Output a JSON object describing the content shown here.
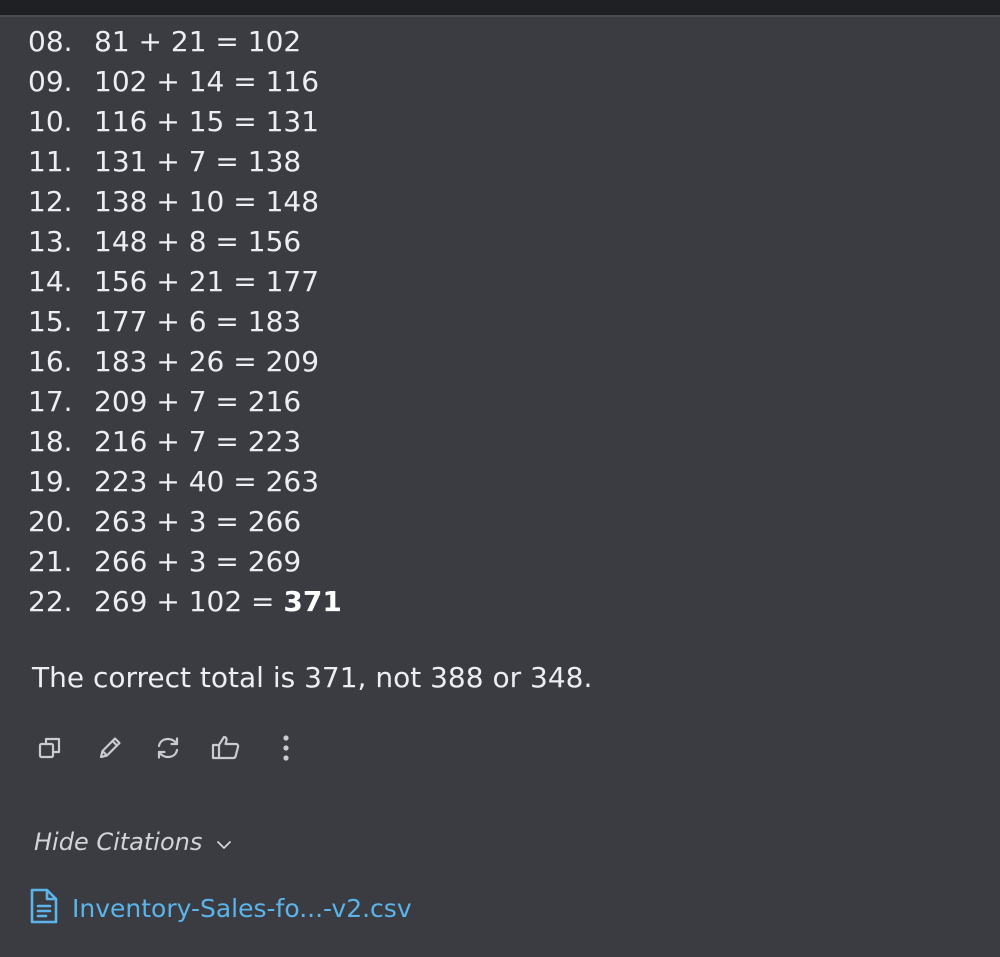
{
  "steps": [
    {
      "num": "08.",
      "expr": "81 + 21 = 102",
      "result_bold": ""
    },
    {
      "num": "09.",
      "expr": "102 + 14 = 116",
      "result_bold": ""
    },
    {
      "num": "10.",
      "expr": "116 + 15 = 131",
      "result_bold": ""
    },
    {
      "num": "11.",
      "expr": "131 + 7 = 138",
      "result_bold": ""
    },
    {
      "num": "12.",
      "expr": "138 + 10 = 148",
      "result_bold": ""
    },
    {
      "num": "13.",
      "expr": "148 + 8 = 156",
      "result_bold": ""
    },
    {
      "num": "14.",
      "expr": "156 + 21 = 177",
      "result_bold": ""
    },
    {
      "num": "15.",
      "expr": "177 + 6 = 183",
      "result_bold": ""
    },
    {
      "num": "16.",
      "expr": "183 + 26 = 209",
      "result_bold": ""
    },
    {
      "num": "17.",
      "expr": "209 + 7 = 216",
      "result_bold": ""
    },
    {
      "num": "18.",
      "expr": "216 + 7 = 223",
      "result_bold": ""
    },
    {
      "num": "19.",
      "expr": "223 + 40 = 263",
      "result_bold": ""
    },
    {
      "num": "20.",
      "expr": "263 + 3 = 266",
      "result_bold": ""
    },
    {
      "num": "21.",
      "expr": "266 + 3 = 269",
      "result_bold": ""
    },
    {
      "num": "22.",
      "expr": "269 + 102 = ",
      "result_bold": "371"
    }
  ],
  "conclusion": "The correct total is 371, not 388 or 348.",
  "actions": [
    {
      "name": "copy-icon"
    },
    {
      "name": "edit-icon"
    },
    {
      "name": "regenerate-icon"
    },
    {
      "name": "thumbs-up-icon"
    },
    {
      "name": "more-options-icon"
    }
  ],
  "citations": {
    "toggle_label": "Hide Citations",
    "items": [
      {
        "label": "Inventory-Sales-fo...-v2.csv",
        "icon": "file-text-icon"
      }
    ]
  },
  "colors": {
    "background": "#3a3c42",
    "text": "#eceef1",
    "link": "#5bb4ea",
    "icon": "#c9cbd0"
  }
}
